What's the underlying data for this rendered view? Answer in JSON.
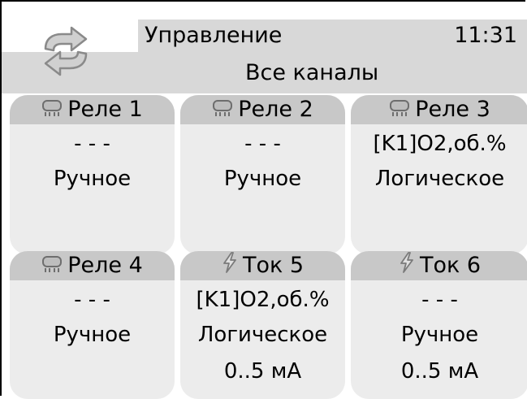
{
  "header": {
    "title": "Управление",
    "clock": "11:31",
    "subtitle": "Все каналы",
    "sync_icon": "sync-arrows-icon"
  },
  "channels": [
    {
      "icon": "relay-icon",
      "name": "Реле 1",
      "value": "- - -",
      "mode": "Ручное",
      "range": ""
    },
    {
      "icon": "relay-icon",
      "name": "Реле 2",
      "value": "- - -",
      "mode": "Ручное",
      "range": ""
    },
    {
      "icon": "relay-icon",
      "name": "Реле 3",
      "value": "[K1]O2,об.%",
      "mode": "Логическое",
      "range": ""
    },
    {
      "icon": "relay-icon",
      "name": "Реле 4",
      "value": "- - -",
      "mode": "Ручное",
      "range": ""
    },
    {
      "icon": "lightning-icon",
      "name": "Ток 5",
      "value": "[K1]O2,об.%",
      "mode": "Логическое",
      "range": "0..5 мА"
    },
    {
      "icon": "lightning-icon",
      "name": "Ток 6",
      "value": "- - -",
      "mode": "Ручное",
      "range": "0..5 мА"
    }
  ]
}
